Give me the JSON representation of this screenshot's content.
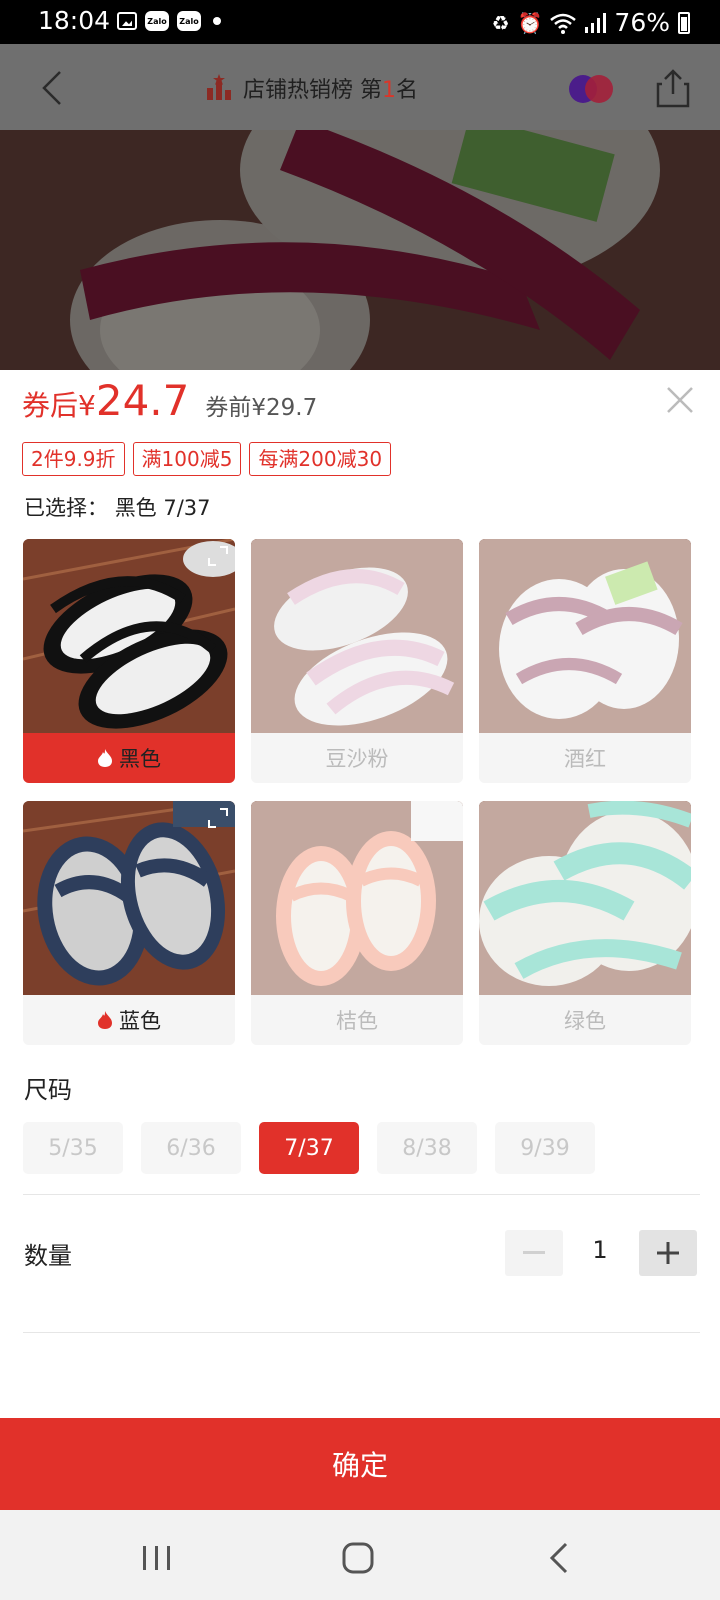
{
  "status_bar": {
    "time": "18:04",
    "notif_apps": [
      "Zalo",
      "Zalo"
    ],
    "battery": "76%"
  },
  "header": {
    "rank_text": "店铺热销榜 第",
    "rank_number": "1",
    "rank_suffix": "名"
  },
  "price": {
    "after_label": "券后",
    "currency": "¥",
    "value": "24.7",
    "before_label": "券前¥29.7"
  },
  "promos": [
    "2件9.9折",
    "满100减5",
    "每满200减30"
  ],
  "selected": {
    "label": "已选择：",
    "value": "黑色 7/37"
  },
  "colors": [
    {
      "label": "黑色",
      "state": "selected",
      "hot": true,
      "shoe_color": "#111111"
    },
    {
      "label": "豆沙粉",
      "state": "disabled",
      "hot": false,
      "shoe_color": "#d9a6c2"
    },
    {
      "label": "酒红",
      "state": "disabled",
      "hot": false,
      "shoe_color": "#8a3a57"
    },
    {
      "label": "蓝色",
      "state": "available",
      "hot": true,
      "shoe_color": "#2e3e5c"
    },
    {
      "label": "桔色",
      "state": "disabled",
      "hot": false,
      "shoe_color": "#f08a6b"
    },
    {
      "label": "绿色",
      "state": "disabled",
      "hot": false,
      "shoe_color": "#3fc6a9"
    }
  ],
  "size": {
    "title": "尺码",
    "options": [
      "5/35",
      "6/36",
      "7/37",
      "8/38",
      "9/39"
    ],
    "selected": "7/37"
  },
  "quantity": {
    "label": "数量",
    "value": "1"
  },
  "confirm_label": "确定",
  "accent": "#e1312a"
}
